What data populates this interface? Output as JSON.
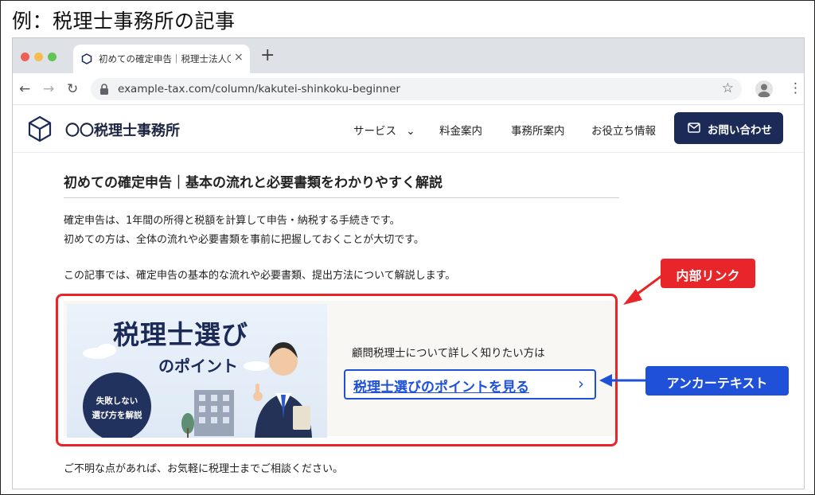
{
  "caption": "例：税理士事務所の記事",
  "browser": {
    "tab_title": "初めての確定申告｜税理士法人〇〇",
    "tab_close": "×",
    "new_tab": "+",
    "url": "example-tax.com/column/kakutei-shinkoku-beginner",
    "nav": {
      "back": "←",
      "forward": "→",
      "reload": "↻",
      "star": "☆",
      "menu": "⋮"
    }
  },
  "site": {
    "name": "〇〇税理士事務所",
    "nav_items": [
      "サービス",
      "料金案内",
      "事務所案内",
      "お役立ち情報"
    ],
    "service_chevron": "⌄",
    "contact_label": "お問い合わせ"
  },
  "article": {
    "title": "初めての確定申告｜基本の流れと必要書類をわかりやすく解説",
    "para1_line1": "確定申告は、1年間の所得と税額を計算して申告・納税する手続きです。",
    "para1_line2": "初めての方は、全体の流れや必要書類を事前に把握しておくことが大切です。",
    "para2": "この記事では、確定申告の基本的な流れや必要書類、提出方法について解説します。",
    "closing": "ご不明な点があれば、お気軽に税理士までご相談ください。"
  },
  "link_card": {
    "banner_title": "税理士選び",
    "banner_subtitle": "のポイント",
    "badge_line1": "失敗しない",
    "badge_line2": "選び方を解説",
    "lead": "顧問税理士について詳しく知りたい方は",
    "anchor_text": "税理士選びのポイントを見る",
    "anchor_chevron": "›"
  },
  "annotations": {
    "internal_link": "内部リンク",
    "anchor_text_label": "アンカーテキスト"
  },
  "colors": {
    "annotation_red": "#e8262a",
    "annotation_blue": "#1e50d8",
    "brand_navy": "#1b2a57"
  }
}
